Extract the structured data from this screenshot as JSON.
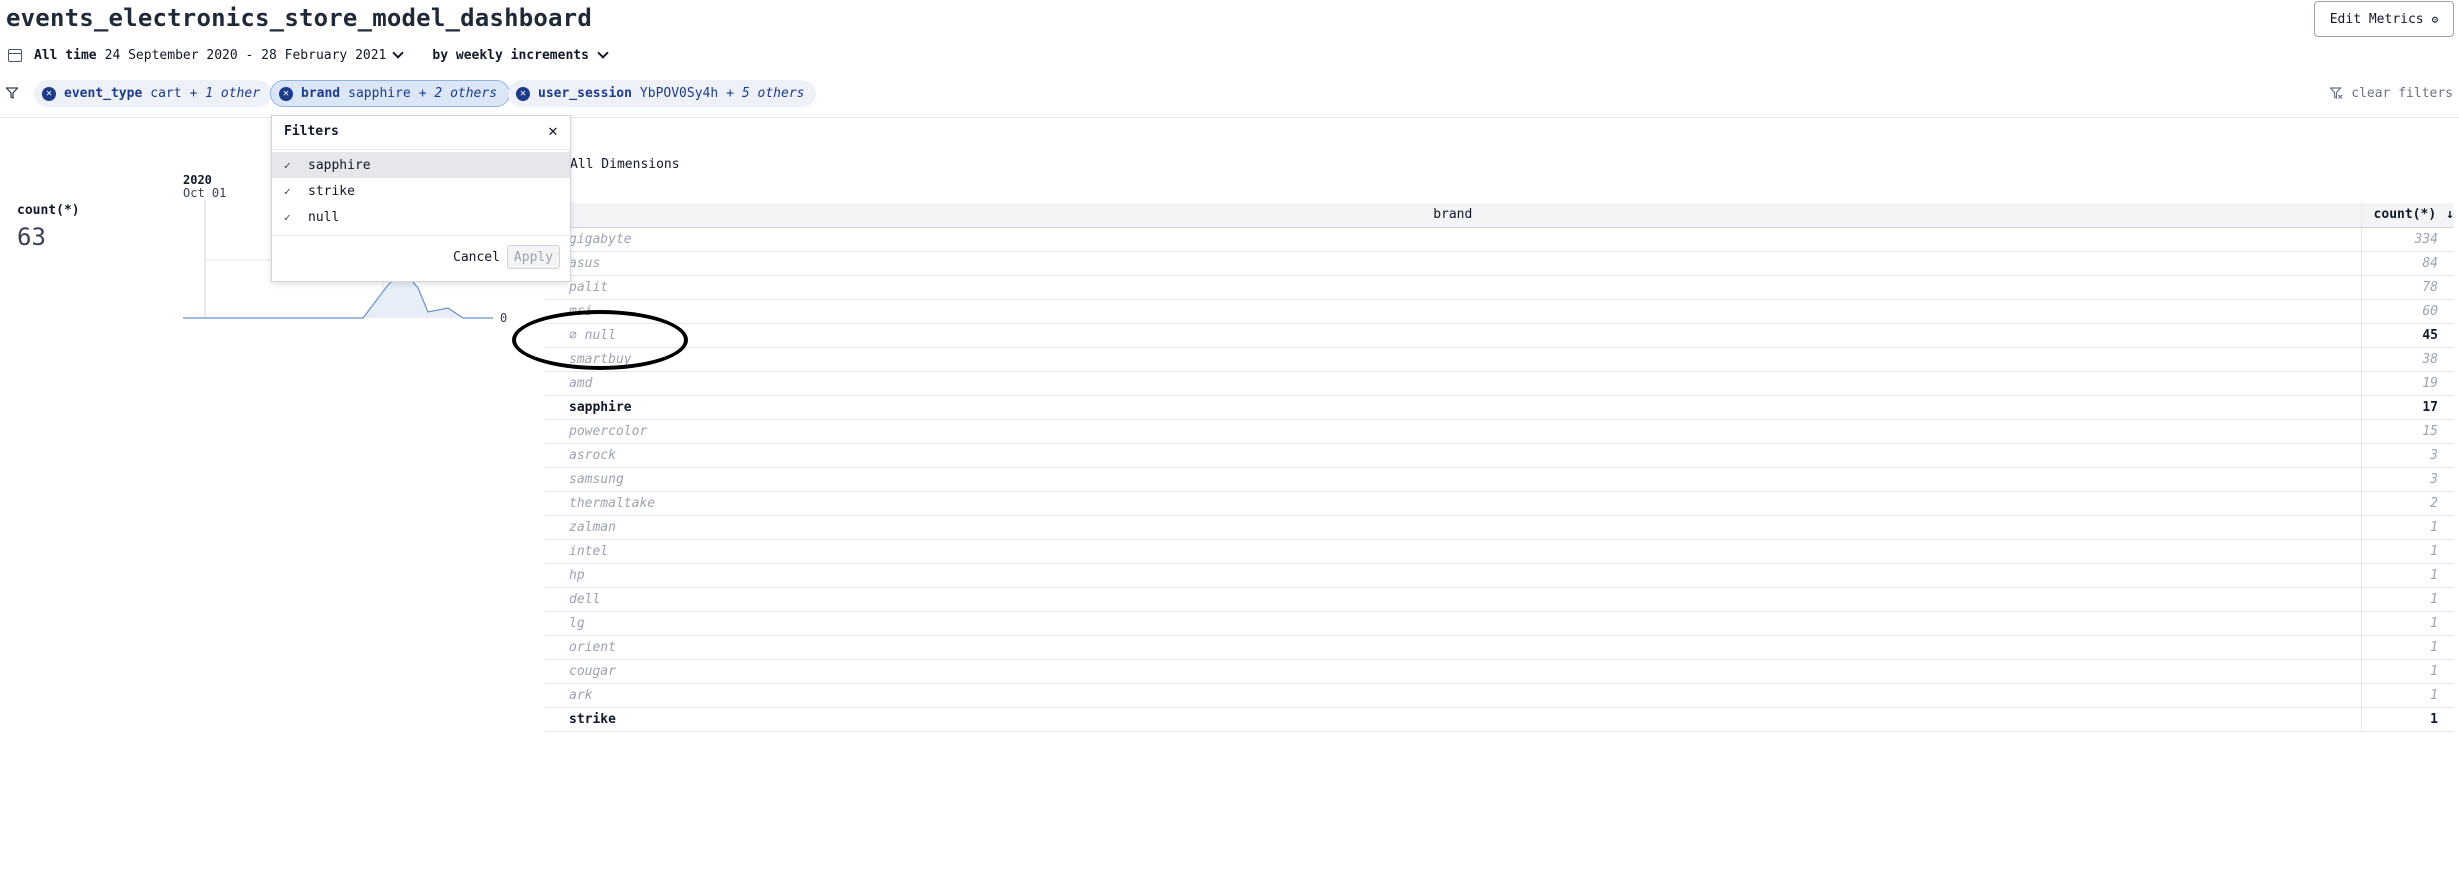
{
  "header": {
    "title": "events_electronics_store_model_dashboard",
    "edit_metrics_label": "Edit Metrics"
  },
  "time_controls": {
    "range_label": "All time",
    "range_dates": "24 September 2020 - 28 February 2021",
    "grain_label": "by weekly increments"
  },
  "filters": {
    "pills": [
      {
        "dimension": "event_type",
        "values": "cart",
        "others": "+ 1 other"
      },
      {
        "dimension": "brand",
        "values": "sapphire",
        "others": "+ 2 others"
      },
      {
        "dimension": "user_session",
        "values": "YbPOV0Sy4h",
        "others": "+ 5 others"
      }
    ],
    "clear_label": "clear filters"
  },
  "metric": {
    "label": "count(*)",
    "value": "63",
    "spark_year": "2020",
    "spark_date": "Oct 01",
    "spark_zero_label": "0"
  },
  "popup": {
    "title": "Filters",
    "options": [
      {
        "label": "sapphire",
        "checked": true
      },
      {
        "label": "strike",
        "checked": true
      },
      {
        "label": "null",
        "checked": true
      }
    ],
    "cancel_label": "Cancel",
    "apply_label": "Apply"
  },
  "table": {
    "section_title": "All Dimensions",
    "header_brand": "brand",
    "header_count": "count(*)",
    "rows": [
      {
        "brand": "gigabyte",
        "count": "334"
      },
      {
        "brand": "asus",
        "count": "84"
      },
      {
        "brand": "palit",
        "count": "78"
      },
      {
        "brand": "msi",
        "count": "60"
      },
      {
        "brand": "∅ null",
        "count": "45"
      },
      {
        "brand": "smartbuy",
        "count": "38"
      },
      {
        "brand": "amd",
        "count": "19"
      },
      {
        "brand": "sapphire",
        "count": "17"
      },
      {
        "brand": "powercolor",
        "count": "15"
      },
      {
        "brand": "asrock",
        "count": "3"
      },
      {
        "brand": "samsung",
        "count": "3"
      },
      {
        "brand": "thermaltake",
        "count": "2"
      },
      {
        "brand": "zalman",
        "count": "1"
      },
      {
        "brand": "intel",
        "count": "1"
      },
      {
        "brand": "hp",
        "count": "1"
      },
      {
        "brand": "dell",
        "count": "1"
      },
      {
        "brand": "lg",
        "count": "1"
      },
      {
        "brand": "orient",
        "count": "1"
      },
      {
        "brand": "cougar",
        "count": "1"
      },
      {
        "brand": "ark",
        "count": "1"
      },
      {
        "brand": "strike",
        "count": "1"
      }
    ]
  }
}
